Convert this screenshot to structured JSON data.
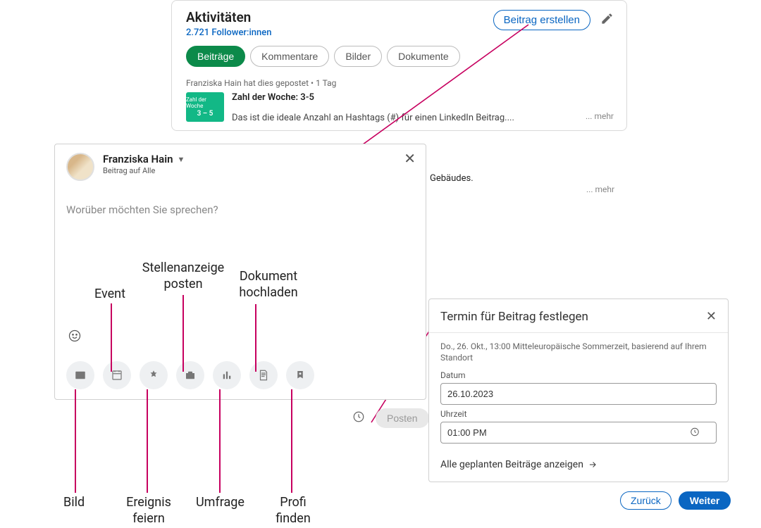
{
  "activity": {
    "title": "Aktivitäten",
    "followers": "2.721 Follower:innen",
    "create_btn": "Beitrag erstellen",
    "tabs": [
      "Beiträge",
      "Kommentare",
      "Bilder",
      "Dokumente"
    ],
    "post_meta": "Franziska Hain hat dies gepostet • 1 Tag",
    "thumb_small": "Zahl der Woche",
    "thumb_big": "3 – 5",
    "post_title": "Zahl der Woche: 3-5",
    "post_text": "Das ist die ideale Anzahl an Hashtags (#) für einen LinkedIn Beitrag....",
    "more": "... mehr"
  },
  "bg": {
    "text": "Gebäudes.",
    "more": "... mehr"
  },
  "compose": {
    "author": "Franziska Hain",
    "audience": "Beitrag auf Alle",
    "placeholder": "Worüber möchten Sie sprechen?",
    "posten": "Posten"
  },
  "annotations": {
    "bild": "Bild",
    "event": "Event",
    "ereignis": "Ereignis feiern",
    "stellen": "Stellenanzeige posten",
    "umfrage": "Umfrage",
    "dokument": "Dokument hochladen",
    "profi": "Profi finden"
  },
  "schedule": {
    "title": "Termin für Beitrag festlegen",
    "hint": "Do., 26. Okt., 13:00 Mitteleuropäische Sommerzeit, basierend auf Ihrem Standort",
    "date_label": "Datum",
    "date_value": "26.10.2023",
    "time_label": "Uhrzeit",
    "time_value": "01:00 PM",
    "link": "Alle geplanten Beiträge anzeigen",
    "back": "Zurück",
    "next": "Weiter"
  }
}
